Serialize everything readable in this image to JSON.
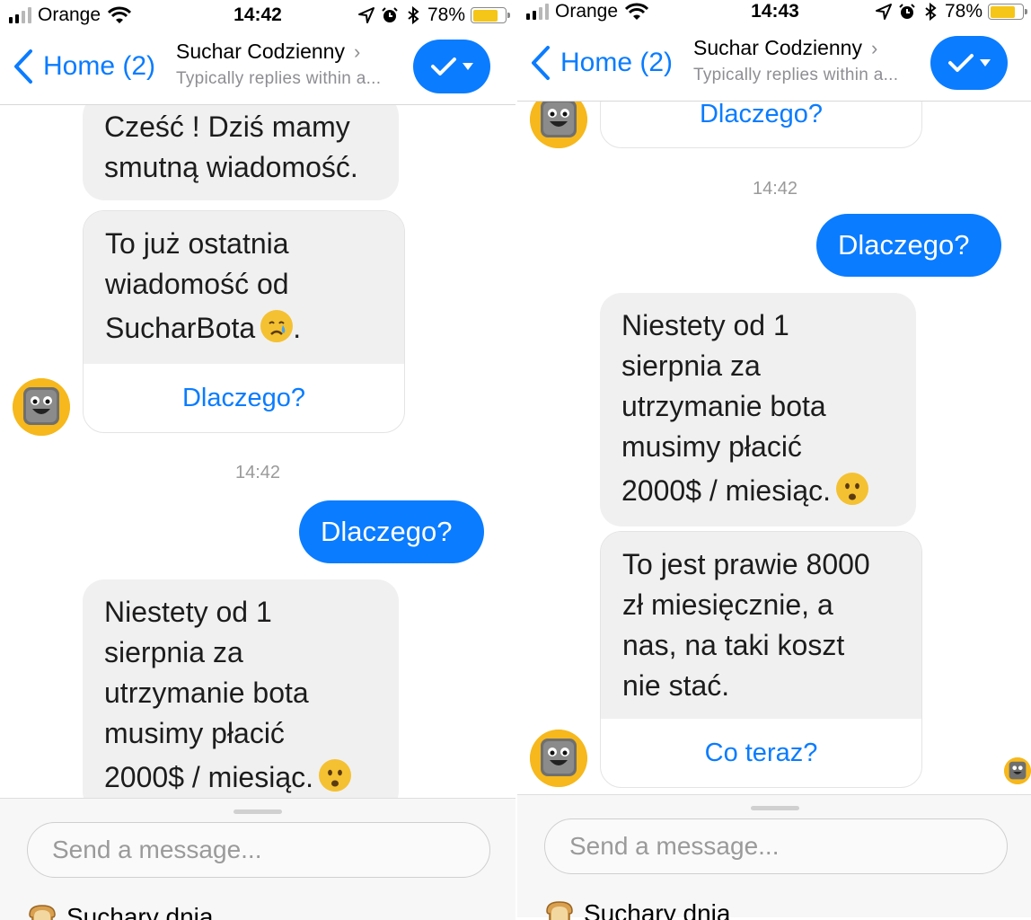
{
  "colors": {
    "accent": "#0a7cff",
    "incoming_bubble": "#f1f0f0",
    "battery": "#f5c518",
    "avatar_bg": "#f6b81c"
  },
  "panels": [
    {
      "status": {
        "carrier": "Orange",
        "time": "14:42",
        "battery": "78%"
      },
      "nav": {
        "back_label": "Home (2)",
        "title": "Suchar Codzienny",
        "subtitle": "Typically replies within a..."
      },
      "messages": {
        "m1": [
          "Cześć ! Dziś mamy",
          "smutną wiadomość."
        ],
        "card1": {
          "lines": [
            "To już ostatnia",
            "wiadomość od",
            "SucharBota"
          ],
          "button": "Dlaczego?"
        },
        "timestamp": "14:42",
        "outgoing": "Dlaczego?",
        "m3": [
          "Niestety od 1",
          "sierpnia za",
          "utrzymanie bota",
          "musimy płacić",
          "2000$ / miesiąc."
        ]
      },
      "composer": {
        "placeholder": "Send a message...",
        "quick_reply": "Suchary dnia"
      }
    },
    {
      "status": {
        "carrier": "Orange",
        "time": "14:43",
        "battery": "78%"
      },
      "nav": {
        "back_label": "Home (2)",
        "title": "Suchar Codzienny",
        "subtitle": "Typically replies within a..."
      },
      "messages": {
        "card_top_button": "Dlaczego?",
        "timestamp": "14:42",
        "outgoing": "Dlaczego?",
        "m3": [
          "Niestety od 1",
          "sierpnia za",
          "utrzymanie bota",
          "musimy płacić",
          "2000$ / miesiąc."
        ],
        "card2": {
          "lines": [
            "To jest prawie 8000",
            "zł miesięcznie, a",
            "nas, na taki koszt",
            "nie stać."
          ],
          "button": "Co teraz?"
        }
      },
      "composer": {
        "placeholder": "Send a message...",
        "quick_reply": "Suchary dnia"
      }
    }
  ],
  "icons": {
    "signal": "signal-bars-icon",
    "wifi": "wifi-icon",
    "location": "location-arrow-icon",
    "alarm": "alarm-clock-icon",
    "bluetooth": "bluetooth-icon",
    "back": "chevron-left-icon",
    "check": "checkmark-icon",
    "avatar": "toast-bot-avatar",
    "bread": "bread-icon",
    "crying": "crying-face-emoji",
    "frowning": "frowning-face-emoji"
  }
}
